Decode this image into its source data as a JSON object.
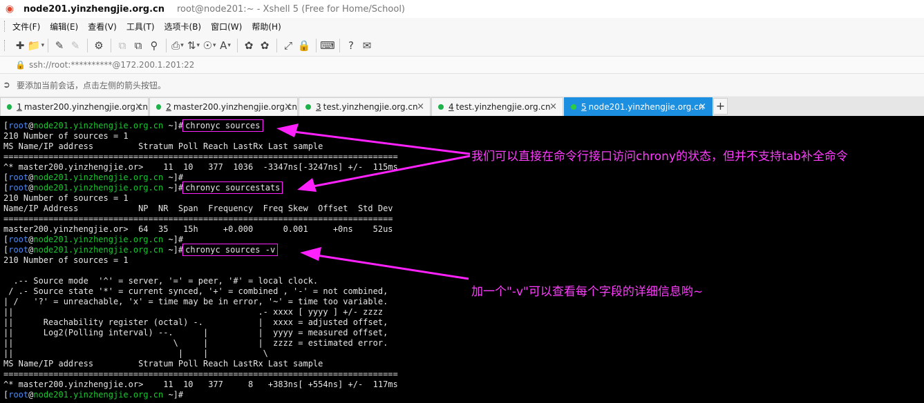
{
  "titlebar": {
    "host": "node201.yinzhengjie.org.cn",
    "title": "root@node201:~ - Xshell 5 (Free for Home/School)"
  },
  "menu": [
    "文件(F)",
    "编辑(E)",
    "查看(V)",
    "工具(T)",
    "选项卡(B)",
    "窗口(W)",
    "帮助(H)"
  ],
  "address": "ssh://root:**********@172.200.1.201:22",
  "hint": "要添加当前会话，点击左侧的箭头按钮。",
  "tabs": [
    {
      "num": "1",
      "label": "master200.yinzhengjie.org.cn",
      "active": false
    },
    {
      "num": "2",
      "label": "master200.yinzhengjie.org.cn",
      "active": false
    },
    {
      "num": "3",
      "label": "test.yinzhengjie.org.cn",
      "active": false
    },
    {
      "num": "4",
      "label": "test.yinzhengjie.org.cn",
      "active": false
    },
    {
      "num": "5",
      "label": "node201.yinzhengjie.org.cn",
      "active": true
    }
  ],
  "prompt": {
    "bracket_open": "[",
    "user": "root",
    "at": "@",
    "host": "node201.yinzhengjie.org.cn",
    "path": " ~]#"
  },
  "terminal": {
    "cmd1": "chronyc sources",
    "l2": "210 Number of sources = 1",
    "l3": "MS Name/IP address         Stratum Poll Reach LastRx Last sample",
    "l4": "===============================================================================",
    "l5": "^* master200.yinzhengjie.or>    11  10   377  1036  -3347ns[-3247ns] +/-  115ms",
    "cmd2": "chronyc sourcestats",
    "l8": "210 Number of sources = 1",
    "l9": "Name/IP Address            NP  NR  Span  Frequency  Freq Skew  Offset  Std Dev",
    "l10": "==============================================================================",
    "l11": "master200.yinzhengjie.or>  64  35   15h     +0.000      0.001     +0ns    52us",
    "cmd3": "chronyc sources -v",
    "l14": "210 Number of sources = 1",
    "l15": "",
    "l16": "  .-- Source mode  '^' = server, '=' = peer, '#' = local clock.",
    "l17": " / .- Source state '*' = current synced, '+' = combined , '-' = not combined,",
    "l18": "| /   '?' = unreachable, 'x' = time may be in error, '~' = time too variable.",
    "l19": "||                                                 .- xxxx [ yyyy ] +/- zzzz",
    "l20": "||      Reachability register (octal) -.           |  xxxx = adjusted offset,",
    "l21": "||      Log2(Polling interval) --.      |          |  yyyy = measured offset,",
    "l22": "||                                \\     |          |  zzzz = estimated error.",
    "l23": "||                                 |    |           \\",
    "l24": "MS Name/IP address         Stratum Poll Reach LastRx Last sample",
    "l25": "===============================================================================",
    "l26": "^* master200.yinzhengjie.or>    11  10   377     8   +383ns[ +554ns] +/-  117ms"
  },
  "annotations": {
    "a1": "我们可以直接在命令行接口访问chrony的状态，但并不支持tab补全命令",
    "a2": "加一个\"-v\"可以查看每个字段的详细信息哟~"
  },
  "colors": {
    "annotation": "#ff3cff",
    "host": "#18c830",
    "user": "#4a8cff",
    "active_tab": "#1c8fe0"
  }
}
